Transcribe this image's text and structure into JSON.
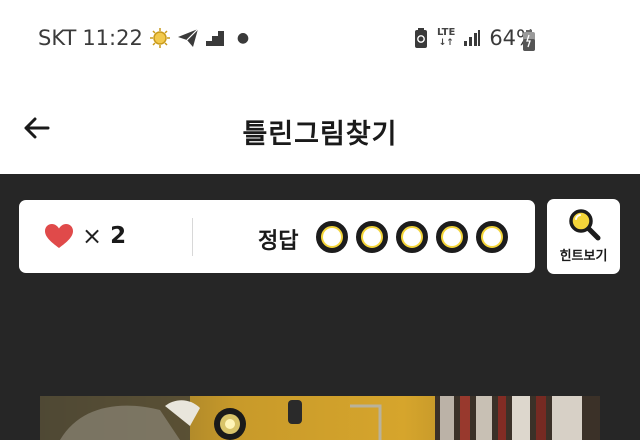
{
  "status_bar": {
    "carrier": "SKT",
    "time": "11:22",
    "network": "LTE",
    "battery": "64%"
  },
  "header": {
    "title": "틀린그림찾기"
  },
  "game": {
    "lives_count": "2",
    "lives_multiplier": "×",
    "answer_label": "정답",
    "answers_found": 0,
    "answers_total": 5,
    "hint_label": "힌트보기"
  },
  "colors": {
    "accent_yellow": "#f4d53a",
    "heart_red": "#e04a4a",
    "dark_bg": "#262626"
  }
}
